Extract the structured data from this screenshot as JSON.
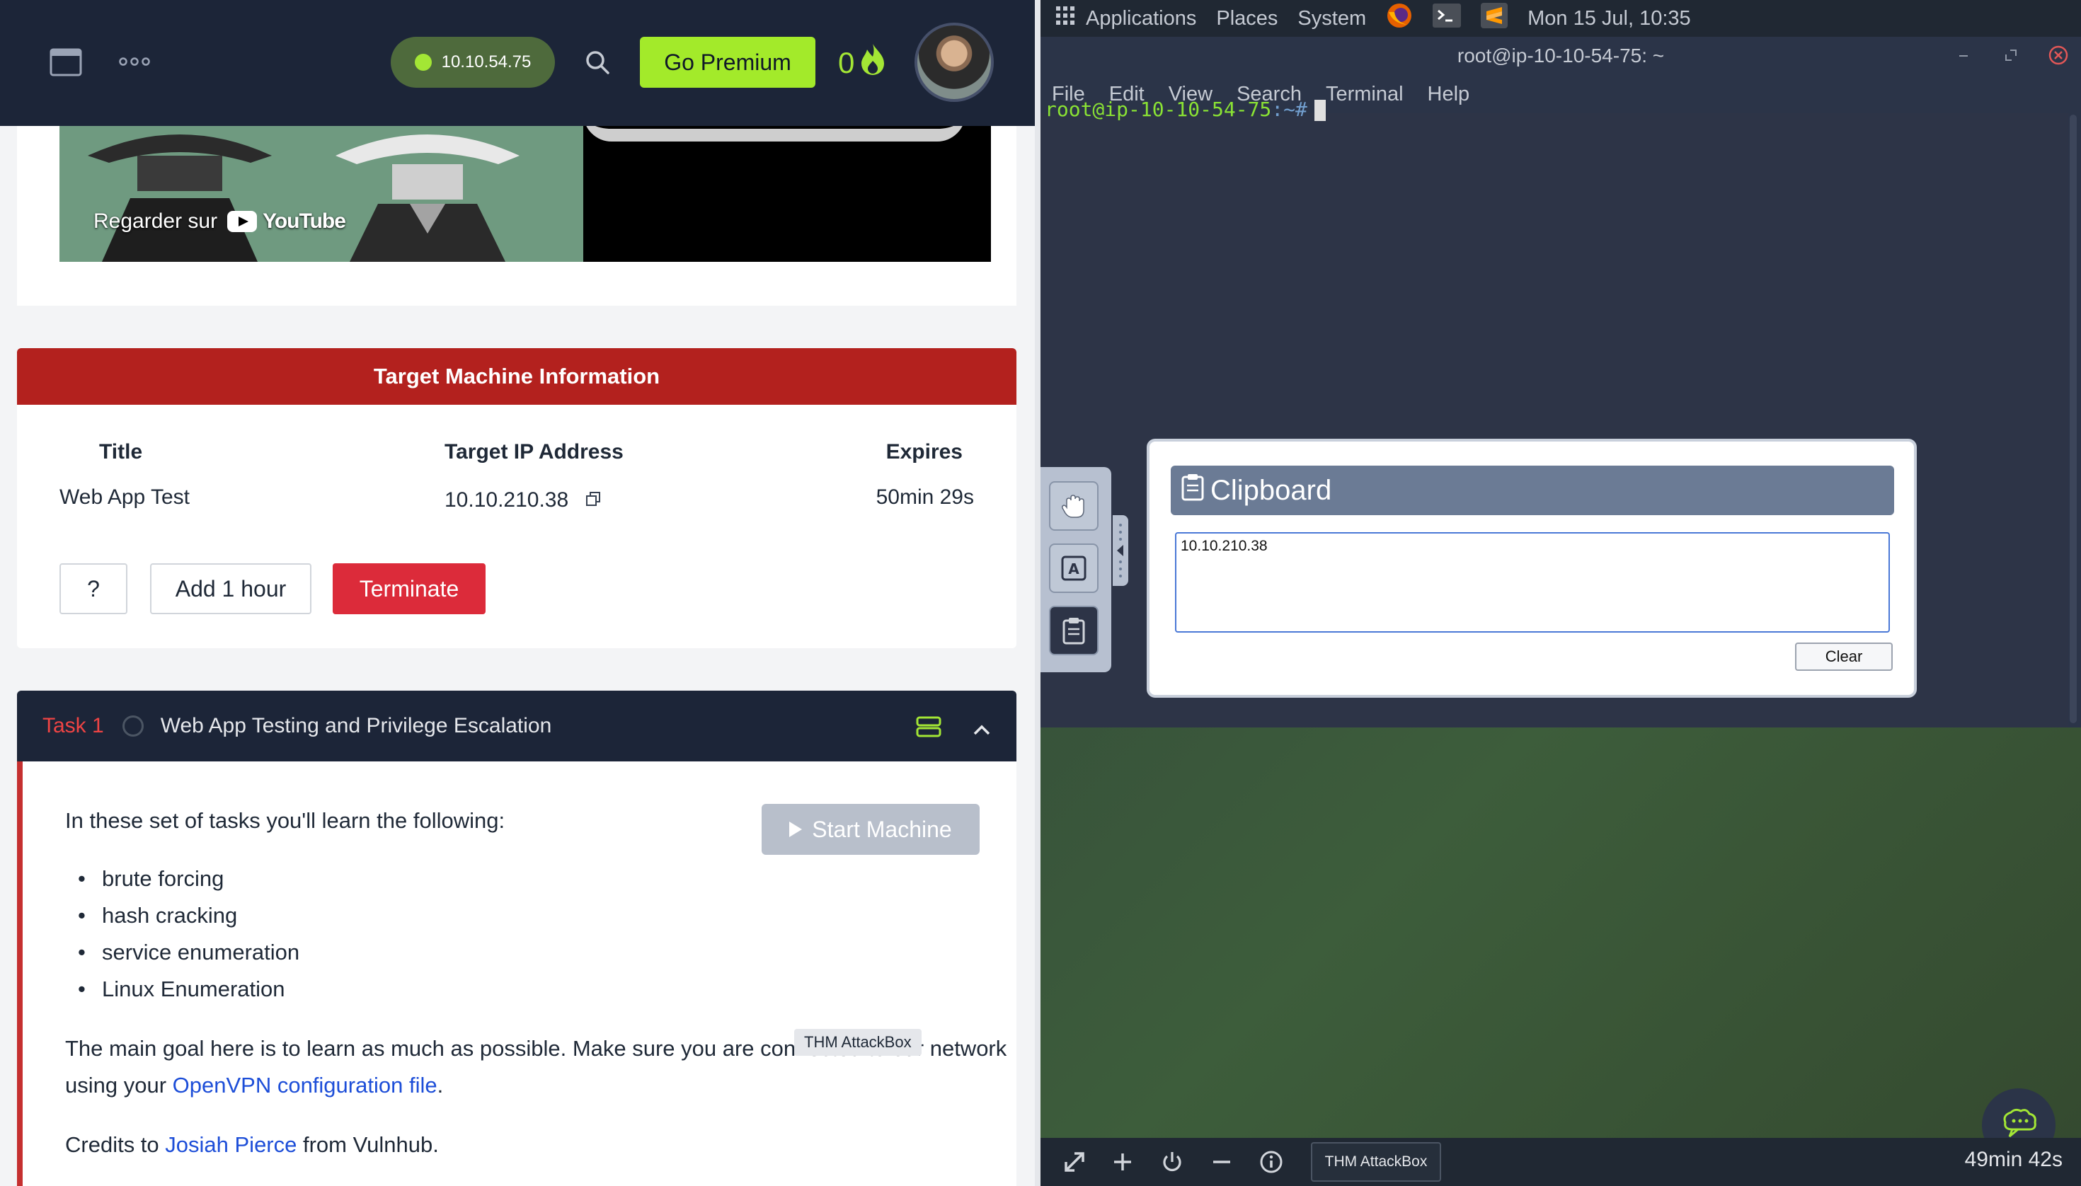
{
  "header": {
    "vpn_ip": "10.10.54.75",
    "premium_label": "Go Premium",
    "streak_count": "0",
    "accent_color": "#a3ea2a"
  },
  "video": {
    "caption_prefix": "Regarder sur",
    "platform_label": "YouTube"
  },
  "target_machine": {
    "heading": "Target Machine Information",
    "columns": [
      "Title",
      "Target IP Address",
      "Expires"
    ],
    "title": "Web App Test",
    "ip": "10.10.210.38",
    "expires": "50min 29s",
    "help_label": "?",
    "add_hour_label": "Add 1 hour",
    "terminate_label": "Terminate"
  },
  "task": {
    "number": "Task 1",
    "title": "Web App Testing and Privilege Escalation",
    "start_machine_label": "Start Machine",
    "intro": "In these set of tasks you'll learn the following:",
    "bullets": [
      "brute forcing",
      "hash cracking",
      "service enumeration",
      "Linux Enumeration"
    ],
    "goal_line1": "The main goal here is to learn as much as possible. Make sure you are connected to our network",
    "goal_line2_prefix": "using your ",
    "goal_link": "OpenVPN configuration file",
    "goal_line2_suffix": ".",
    "credits_prefix": "Credits to ",
    "credits_link": "Josiah Pierce",
    "credits_suffix": " from Vulnhub.",
    "tooltip": "THM AttackBox"
  },
  "desktop": {
    "menu": [
      "Applications",
      "Places",
      "System"
    ],
    "clock": "Mon 15 Jul, 10:35"
  },
  "terminal": {
    "title": "root@ip-10-10-54-75: ~",
    "menu": [
      "File",
      "Edit",
      "View",
      "Search",
      "Terminal",
      "Help"
    ],
    "prompt_user": "root@ip-10-10-54-75",
    "prompt_path": ":~#"
  },
  "clipboard": {
    "heading": "Clipboard",
    "content": "10.10.210.38",
    "clear_label": "Clear"
  },
  "bottom_bar": {
    "tab_label": "THM AttackBox",
    "timer": "49min 42s"
  }
}
